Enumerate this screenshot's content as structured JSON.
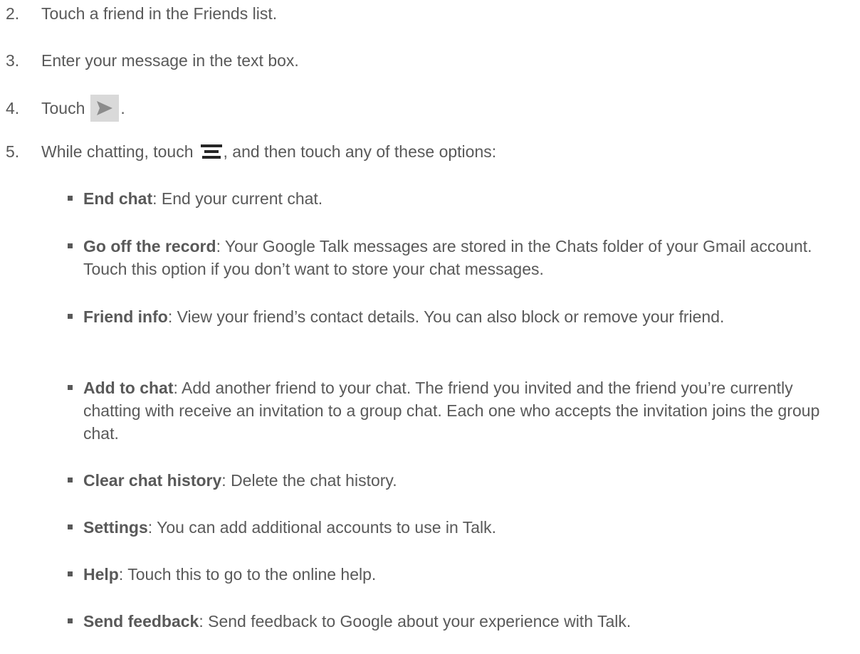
{
  "steps": [
    {
      "number": "2.",
      "text": "Touch a friend in the Friends list."
    },
    {
      "number": "3.",
      "text": "Enter your message in the text box."
    },
    {
      "number": "4.",
      "text_before": "Touch",
      "icon": "send-icon",
      "text_after": "."
    },
    {
      "number": "5.",
      "text_before": "While chatting, touch",
      "icon": "menu-icon",
      "text_after": ", and then touch any of these options:"
    }
  ],
  "options": [
    {
      "term": "End chat",
      "desc": ": End your current chat."
    },
    {
      "term": "Go off the record",
      "desc": ": Your Google Talk messages are stored in the Chats folder of your Gmail account. Touch this option if you don’t want to store your chat messages."
    },
    {
      "term": "Friend info",
      "desc": ": View your friend’s contact details. You can also block or remove your friend."
    },
    {
      "term": "Add to chat",
      "desc": ": Add another friend to your chat. The friend you invited and the friend you’re currently chatting with receive an invitation to a group chat. Each one who accepts the invitation joins the group chat."
    },
    {
      "term": "Clear chat history",
      "desc": ": Delete the chat history."
    },
    {
      "term": "Settings",
      "desc": ": You can add additional accounts to use in Talk."
    },
    {
      "term": "Help",
      "desc": ": Touch this to go to the online help."
    },
    {
      "term": "Send feedback",
      "desc": ": Send feedback to Google about your experience with Talk."
    }
  ],
  "colors": {
    "text": "#595959",
    "icon_dark": "#262626",
    "icon_bg": "#d9d9d9",
    "send_arrow": "#8c8c8c"
  }
}
